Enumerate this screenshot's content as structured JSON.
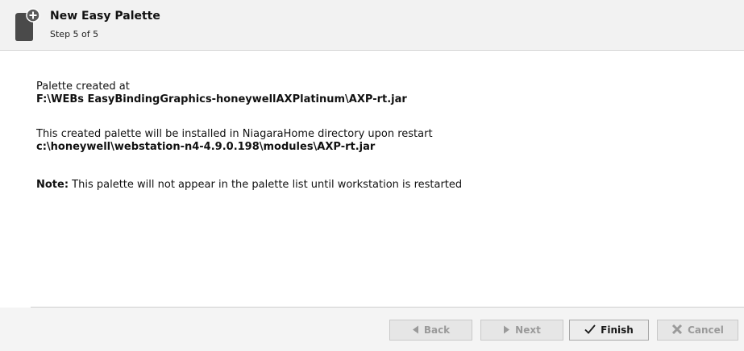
{
  "header": {
    "title": "New Easy Palette",
    "step": "Step 5 of 5",
    "icon": "palette-add-icon"
  },
  "content": {
    "created_label": "Palette created at",
    "created_path": "F:\\WEBs EasyBindingGraphics-honeywellAXPlatinum\\AXP-rt.jar",
    "install_label": "This created palette will be installed in NiagaraHome directory upon restart",
    "install_path": "c:\\honeywell\\webstation-n4-4.9.0.198\\modules\\AXP-rt.jar",
    "note_label": "Note:",
    "note_text": " This palette will not appear in the palette list until workstation is restarted"
  },
  "footer": {
    "back": {
      "label": "Back",
      "icon": "triangle-left-icon",
      "enabled": false
    },
    "next": {
      "label": "Next",
      "icon": "triangle-right-icon",
      "enabled": false
    },
    "finish": {
      "label": "Finish",
      "icon": "checkmark-icon",
      "enabled": true
    },
    "cancel": {
      "label": "Cancel",
      "icon": "x-cancel-icon",
      "enabled": false
    }
  }
}
